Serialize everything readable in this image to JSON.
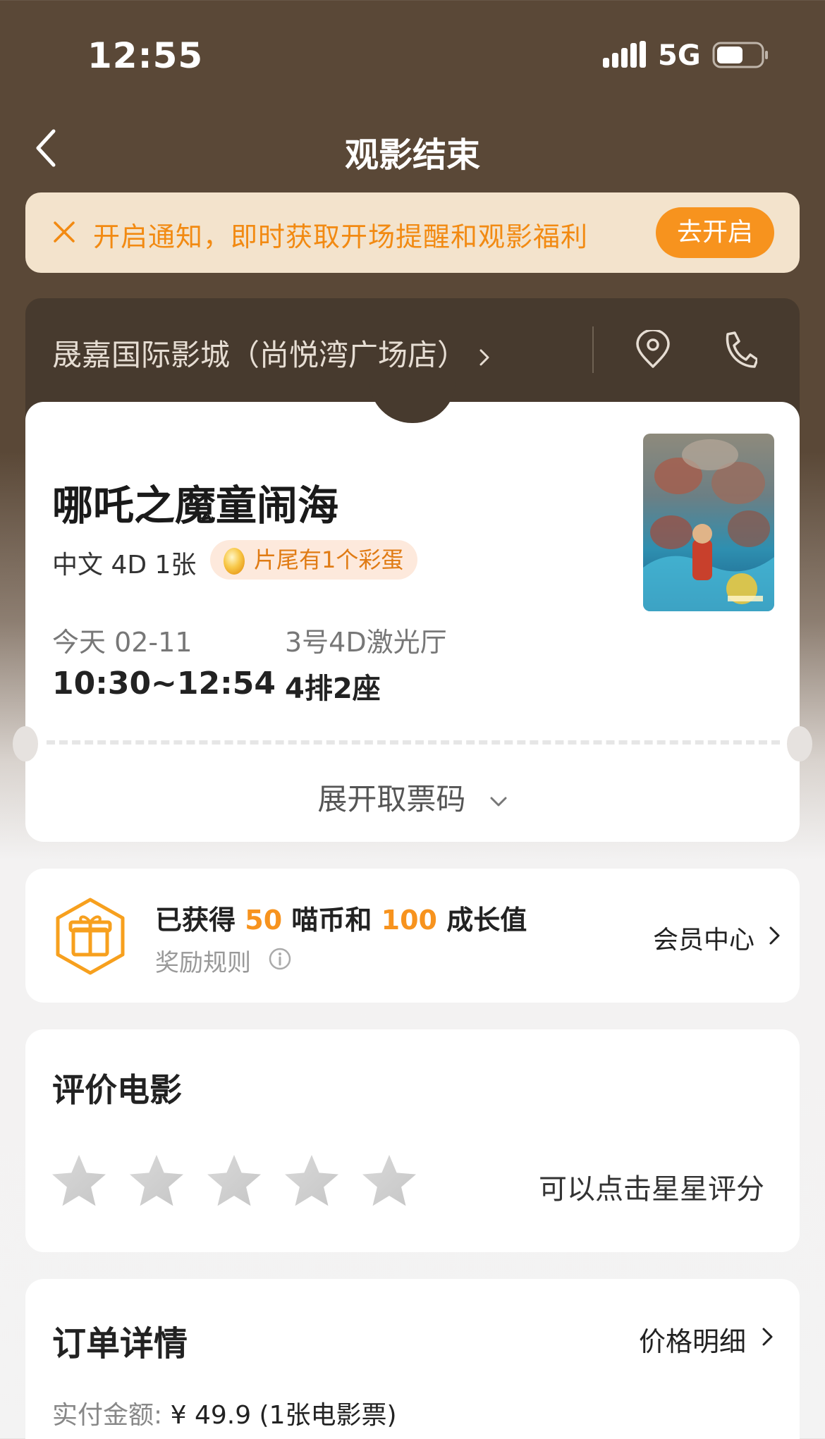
{
  "status_bar": {
    "time": "12:55",
    "network": "5G"
  },
  "nav": {
    "title": "观影结束"
  },
  "notice": {
    "text": "开启通知，即时获取开场提醒和观影福利",
    "button": "去开启"
  },
  "cinema": {
    "name": "晟嘉国际影城（尚悦湾广场店）"
  },
  "ticket": {
    "movie_title": "哪吒之魔童闹海",
    "meta": "中文 4D 1张",
    "egg_badge": "片尾有1个彩蛋",
    "date": "今天 02-11",
    "time": "10:30~12:54",
    "hall": "3号4D激光厅",
    "seat": "4排2座",
    "expand_label": "展开取票码"
  },
  "reward": {
    "prefix": "已获得",
    "coins": "50",
    "middle": "喵币和",
    "growth": "100",
    "suffix": "成长值",
    "rules": "奖励规则",
    "member_link": "会员中心"
  },
  "rating": {
    "title": "评价电影",
    "hint": "可以点击星星评分",
    "stars_total": 5,
    "stars_selected": 0
  },
  "order": {
    "title": "订单详情",
    "price_link": "价格明细",
    "paid_label": "实付金额:",
    "paid_value": "¥ 49.9 (1张电影票)"
  },
  "colors": {
    "accent": "#f7931e",
    "header_bg": "#5a4837",
    "cinema_bar": "#473a2e"
  }
}
